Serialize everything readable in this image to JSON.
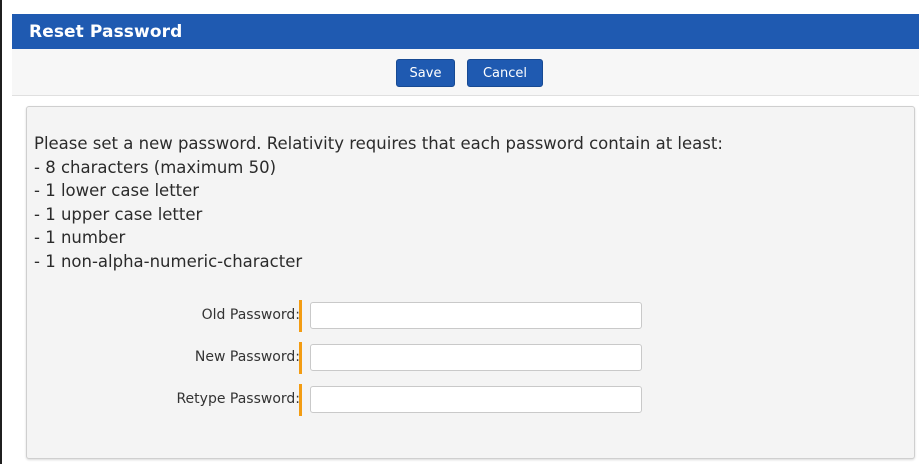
{
  "dialog": {
    "title": "Reset Password"
  },
  "toolbar": {
    "save_label": "Save",
    "cancel_label": "Cancel"
  },
  "instructions": {
    "intro": "Please set a new password. Relativity requires that each password contain at least:",
    "requirements": [
      "- 8 characters (maximum 50)",
      "- 1 lower case letter",
      "- 1 upper case letter",
      "- 1 number",
      "- 1 non-alpha-numeric-character"
    ]
  },
  "form": {
    "old_password": {
      "label": "Old Password:",
      "value": "",
      "placeholder": ""
    },
    "new_password": {
      "label": "New Password:",
      "value": "",
      "placeholder": ""
    },
    "retype_password": {
      "label": "Retype Password:",
      "value": "",
      "placeholder": ""
    }
  },
  "colors": {
    "accent": "#1f5ab1",
    "required_marker": "#f39c12",
    "panel_background": "#f4f4f4"
  }
}
